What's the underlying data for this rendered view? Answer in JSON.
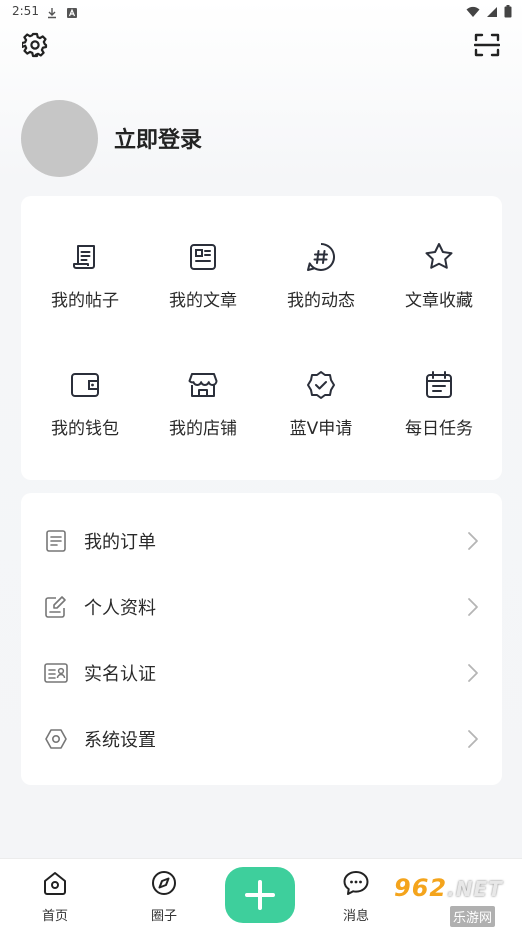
{
  "status_bar": {
    "time": "2:51",
    "left_icons": [
      "download-icon",
      "a-icon"
    ],
    "right_icons": [
      "wifi-icon",
      "signal-icon",
      "battery-icon"
    ]
  },
  "header": {
    "settings_icon": "gear-icon",
    "scan_icon": "scan-icon"
  },
  "profile": {
    "login_label": "立即登录"
  },
  "grid": {
    "items": [
      {
        "label": "我的帖子",
        "icon": "scroll-icon"
      },
      {
        "label": "我的文章",
        "icon": "article-icon"
      },
      {
        "label": "我的动态",
        "icon": "hashtag-icon"
      },
      {
        "label": "文章收藏",
        "icon": "star-icon"
      },
      {
        "label": "我的钱包",
        "icon": "wallet-icon"
      },
      {
        "label": "我的店铺",
        "icon": "store-icon"
      },
      {
        "label": "蓝V申请",
        "icon": "verified-badge-icon"
      },
      {
        "label": "每日任务",
        "icon": "calendar-icon"
      }
    ]
  },
  "menu": {
    "items": [
      {
        "label": "我的订单",
        "icon": "order-icon"
      },
      {
        "label": "个人资料",
        "icon": "edit-profile-icon"
      },
      {
        "label": "实名认证",
        "icon": "id-card-icon"
      },
      {
        "label": "系统设置",
        "icon": "hexagon-settings-icon"
      }
    ]
  },
  "tab_bar": {
    "tabs": [
      {
        "label": "首页",
        "icon": "home-icon"
      },
      {
        "label": "圈子",
        "icon": "compass-icon"
      },
      {
        "label": "消息",
        "icon": "chat-icon"
      }
    ],
    "plus_icon": "plus-icon"
  },
  "watermark": {
    "top": "962",
    "net": ".NET",
    "bottom": "乐游网"
  },
  "colors": {
    "accent": "#3ecf9c",
    "avatar": "#c6c6c6",
    "text": "#2a2a2a",
    "icon": "#2b2f3a"
  }
}
